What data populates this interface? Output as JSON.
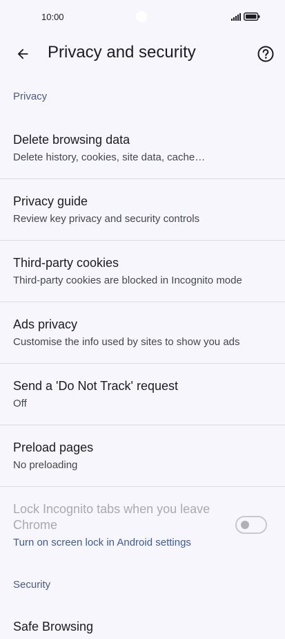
{
  "status_bar": {
    "time": "10:00"
  },
  "header": {
    "title": "Privacy and security"
  },
  "sections": {
    "privacy": "Privacy",
    "security": "Security"
  },
  "items": [
    {
      "title": "Delete browsing data",
      "subtitle": "Delete history, cookies, site data, cache…"
    },
    {
      "title": "Privacy guide",
      "subtitle": "Review key privacy and security controls"
    },
    {
      "title": "Third-party cookies",
      "subtitle": "Third-party cookies are blocked in Incognito mode"
    },
    {
      "title": "Ads privacy",
      "subtitle": "Customise the info used by sites to show you ads"
    },
    {
      "title": "Send a 'Do Not Track' request",
      "subtitle": "Off"
    },
    {
      "title": "Preload pages",
      "subtitle": "No preloading"
    }
  ],
  "lock_incognito": {
    "title": "Lock Incognito tabs when you leave Chrome",
    "link": "Turn on screen lock in Android settings",
    "enabled": false
  },
  "safe_browsing": {
    "title": "Safe Browsing"
  },
  "colors": {
    "background": "#f7f6fd",
    "section": "#4a5a82",
    "link": "#3b5b95",
    "divider": "#dcdbe4"
  }
}
